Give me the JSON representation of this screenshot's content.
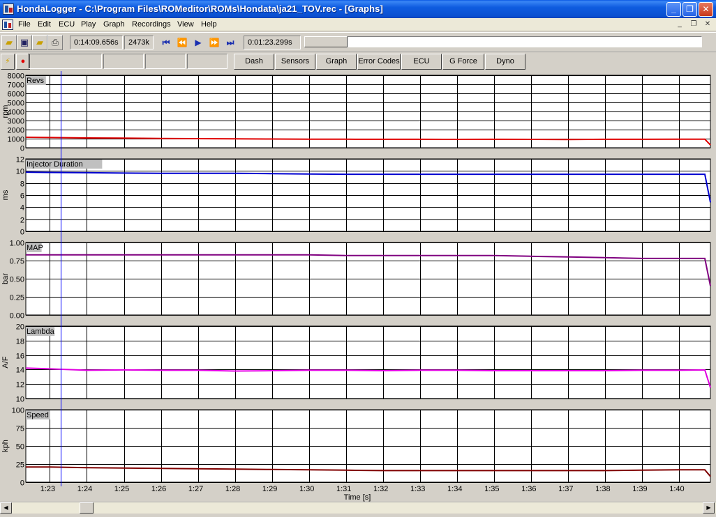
{
  "window": {
    "title": "HondaLogger - C:\\Program Files\\ROMeditor\\ROMs\\Hondata\\ja21_TOV.rec - [Graphs]"
  },
  "menu": {
    "items": [
      "File",
      "Edit",
      "ECU",
      "Play",
      "Graph",
      "Recordings",
      "View",
      "Help"
    ]
  },
  "toolbar": {
    "elapsed": "0:14:09.656s",
    "size": "2473k",
    "position": "0:01:23.299s",
    "progress_fraction": 0.11
  },
  "panel_buttons": [
    "Dash",
    "Sensors",
    "Graph",
    "Error Codes",
    "ECU",
    "G Force",
    "Dyno"
  ],
  "graphs": {
    "x_axis_label": "Time [s]",
    "x_ticks": [
      "1:23",
      "1:24",
      "1:25",
      "1:26",
      "1:27",
      "1:28",
      "1:29",
      "1:30",
      "1:31",
      "1:32",
      "1:33",
      "1:34",
      "1:35",
      "1:36",
      "1:37",
      "1:38",
      "1:39",
      "1:40"
    ],
    "cursor_time_s": 83.3,
    "x_range_s": [
      82.35,
      100.85
    ]
  },
  "chart_data": [
    {
      "type": "line",
      "title": "Revs",
      "ylabel": "rpm",
      "ylim": [
        0,
        8000
      ],
      "y_ticks": [
        "0",
        "1000",
        "2000",
        "3000",
        "4000",
        "5000",
        "6000",
        "7000",
        "8000"
      ],
      "color": "#e00000",
      "x": [
        82.35,
        83,
        84,
        85,
        86,
        87,
        88,
        89,
        90,
        91,
        92,
        93,
        94,
        95,
        96,
        97,
        98,
        99,
        100,
        100.7,
        100.85
      ],
      "values": [
        1150,
        1120,
        1080,
        1060,
        1020,
        1000,
        980,
        960,
        950,
        940,
        930,
        930,
        920,
        930,
        920,
        910,
        930,
        930,
        940,
        950,
        300
      ]
    },
    {
      "type": "line",
      "title": "Injector Duration",
      "ylabel": "ms",
      "ylim": [
        0,
        12
      ],
      "y_ticks": [
        "0",
        "2",
        "4",
        "6",
        "8",
        "10",
        "12"
      ],
      "color": "#0000d0",
      "x": [
        82.35,
        83,
        84,
        85,
        86,
        87,
        88,
        89,
        90,
        91,
        92,
        93,
        94,
        95,
        96,
        97,
        98,
        99,
        100,
        100.7,
        100.85
      ],
      "values": [
        9.8,
        9.75,
        9.7,
        9.65,
        9.6,
        9.6,
        9.6,
        9.55,
        9.5,
        9.45,
        9.45,
        9.45,
        9.45,
        9.45,
        9.45,
        9.45,
        9.45,
        9.45,
        9.45,
        9.45,
        4.8
      ]
    },
    {
      "type": "line",
      "title": "MAP",
      "ylabel": "bar",
      "ylim": [
        0,
        1
      ],
      "y_ticks": [
        "0.00",
        "0.25",
        "0.50",
        "0.75",
        "1.00"
      ],
      "color": "#800080",
      "x": [
        82.35,
        83,
        84,
        85,
        86,
        87,
        88,
        89,
        90,
        91,
        92,
        93,
        94,
        95,
        96,
        97,
        98,
        99,
        100,
        100.7,
        100.85
      ],
      "values": [
        0.83,
        0.83,
        0.83,
        0.83,
        0.83,
        0.83,
        0.83,
        0.83,
        0.83,
        0.82,
        0.82,
        0.82,
        0.82,
        0.82,
        0.81,
        0.8,
        0.79,
        0.78,
        0.78,
        0.78,
        0.4
      ]
    },
    {
      "type": "line",
      "title": "Lambda",
      "ylabel": "A/F",
      "ylim": [
        10,
        20
      ],
      "y_ticks": [
        "10",
        "12",
        "14",
        "16",
        "18",
        "20"
      ],
      "color": "#e000e0",
      "x": [
        82.35,
        83,
        84,
        85,
        86,
        87,
        88,
        89,
        90,
        91,
        92,
        93,
        94,
        95,
        96,
        97,
        98,
        99,
        100,
        100.7,
        100.85
      ],
      "values": [
        14.2,
        14.1,
        13.9,
        13.95,
        13.9,
        13.9,
        13.8,
        13.85,
        13.9,
        13.9,
        13.85,
        13.9,
        13.9,
        13.85,
        13.85,
        13.85,
        13.85,
        13.9,
        13.9,
        13.95,
        11.5
      ]
    },
    {
      "type": "line",
      "title": "Speed",
      "ylabel": "kph",
      "ylim": [
        0,
        100
      ],
      "y_ticks": [
        "0",
        "25",
        "50",
        "75",
        "100"
      ],
      "color": "#800000",
      "x": [
        82.35,
        83,
        84,
        85,
        86,
        87,
        88,
        89,
        90,
        91,
        92,
        93,
        94,
        95,
        96,
        97,
        98,
        99,
        100,
        100.7,
        100.85
      ],
      "values": [
        21,
        21,
        20,
        19.5,
        19,
        18.5,
        18,
        17.5,
        17,
        16.5,
        16,
        16,
        16,
        16,
        16,
        16,
        16,
        16.5,
        17,
        17,
        8
      ]
    }
  ]
}
